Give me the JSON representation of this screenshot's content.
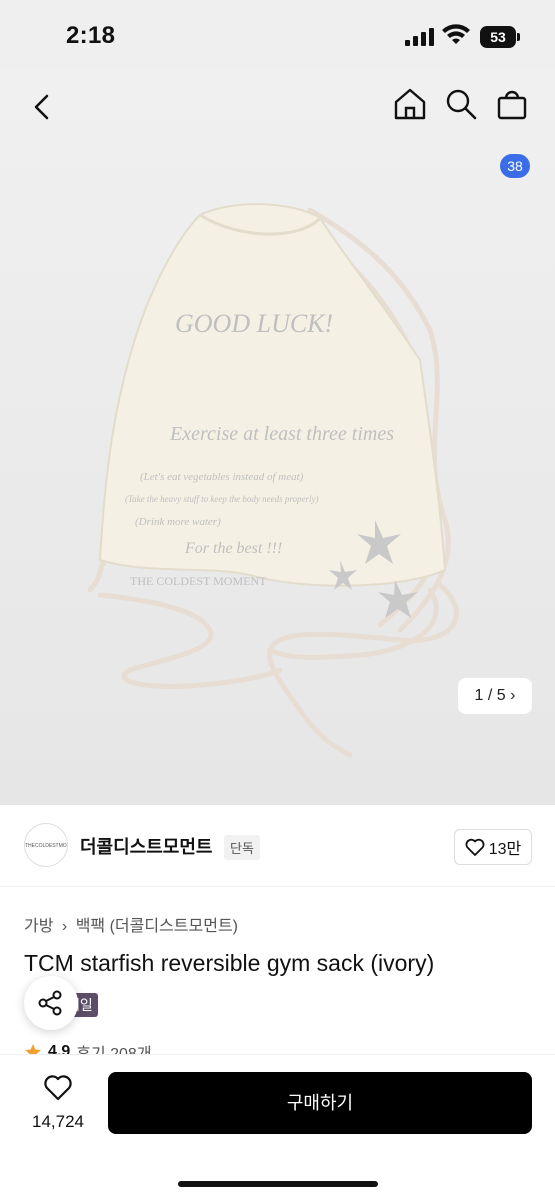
{
  "status": {
    "time": "2:18",
    "battery": "53"
  },
  "nav": {
    "cart_count": "38"
  },
  "gallery": {
    "pager": "1 / 5",
    "product_print_text": [
      "GOOD LUCK!",
      "Exercise at least three times",
      "(Let's eat vegetables instead of meat)",
      "(Take the heavy stuff to keep the body needs properly)",
      "(Drink more water)",
      "For the best !!!",
      "THE COLDEST MOMENT"
    ]
  },
  "brand": {
    "logo_text": "THECOLDESTMOMENT",
    "name": "더콜디스트모먼트",
    "tag": "단독",
    "likes": "13만"
  },
  "breadcrumb": {
    "category": "가방",
    "sub": "백팩 (더콜디스트모먼트)"
  },
  "product": {
    "title": "TCM starfish reversible gym sack (ivory)",
    "badge": "세일",
    "rating": "4.9",
    "reviews": "후기 208개"
  },
  "bottom": {
    "wish_count": "14,724",
    "buy_label": "구매하기"
  },
  "colors": {
    "accent": "#3b6de8",
    "sale_badge": "#5c4d69",
    "buy_bg": "#000000",
    "star": "#f0a030"
  }
}
